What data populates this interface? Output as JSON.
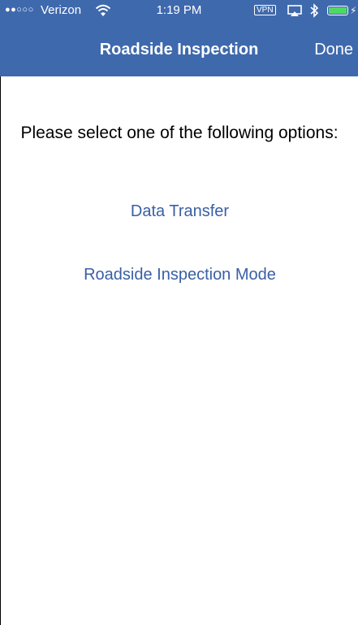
{
  "status_bar": {
    "signal": "●●○○○",
    "carrier": "Verizon",
    "time": "1:19 PM",
    "vpn": "VPN",
    "bolt": "⚡"
  },
  "nav": {
    "title": "Roadside Inspection",
    "done_label": "Done"
  },
  "main": {
    "prompt": "Please select one of the following options:",
    "options": [
      {
        "label": "Data Transfer"
      },
      {
        "label": "Roadside Inspection Mode"
      }
    ]
  },
  "colors": {
    "header_bg": "#3f69ad",
    "link": "#3a5fa5",
    "battery": "#4cd964"
  }
}
